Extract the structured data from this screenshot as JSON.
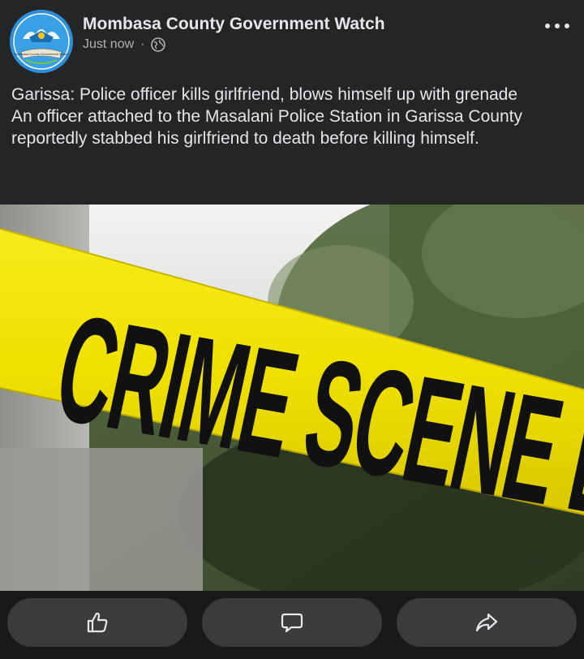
{
  "post": {
    "page_name": "Mombasa County Government Watch",
    "timestamp": "Just now",
    "separator": "·",
    "audience_icon": "globe-icon",
    "more_icon": "more-horizontal-icon",
    "avatar_banner_text": "Mombasa County Government Watch",
    "text_lines": [
      "Garissa: Police officer kills girlfriend, blows himself up with grenade",
      "An officer attached to the Masalani Police Station in Garissa County reportedly stabbed his girlfriend to death before killing himself."
    ],
    "image": {
      "tape_text": "CRIME SCENE DO NOT CROSS",
      "tape_color": "#f2e600"
    }
  },
  "actions": {
    "like_icon": "thumbs-up-icon",
    "comment_icon": "comment-icon",
    "share_icon": "share-icon"
  },
  "colors": {
    "background": "#242526",
    "text": "#e4e6eb",
    "secondary_text": "#b0b3b8",
    "button": "#3a3b3c"
  }
}
